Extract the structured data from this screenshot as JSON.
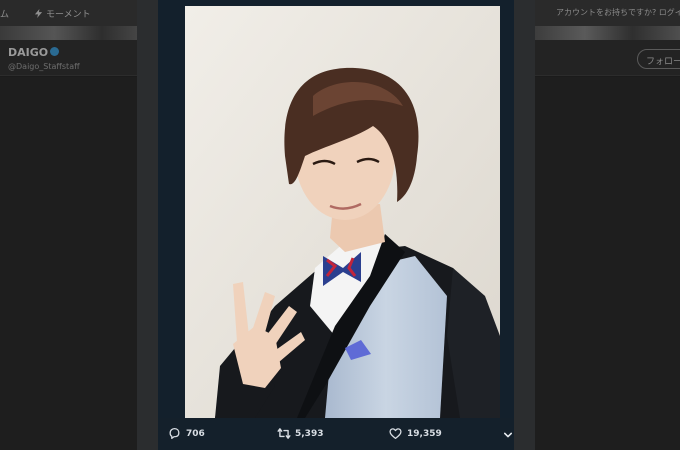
{
  "background_page": {
    "nav": {
      "home_label": "ム",
      "moments_label": "モーメント",
      "account_text": "アカウントをお持ちですか? ログイン"
    },
    "profile": {
      "name": "DAIGO",
      "handle": "@Daigo_Staffstaff",
      "follow_label": "フォロー"
    }
  },
  "tweet": {
    "reply_count": "706",
    "retweet_count": "5,393",
    "like_count": "19,359"
  },
  "icons": {
    "reply": "reply-bubble-icon",
    "retweet": "retweet-arrows-icon",
    "like": "heart-icon",
    "more": "chevron-down-icon",
    "moments": "lightning-icon",
    "verified": "verified-badge-icon"
  },
  "colors": {
    "overlay": "#1b1b1b",
    "modal_frame": "#13202c",
    "action_text": "#d8dde3"
  }
}
